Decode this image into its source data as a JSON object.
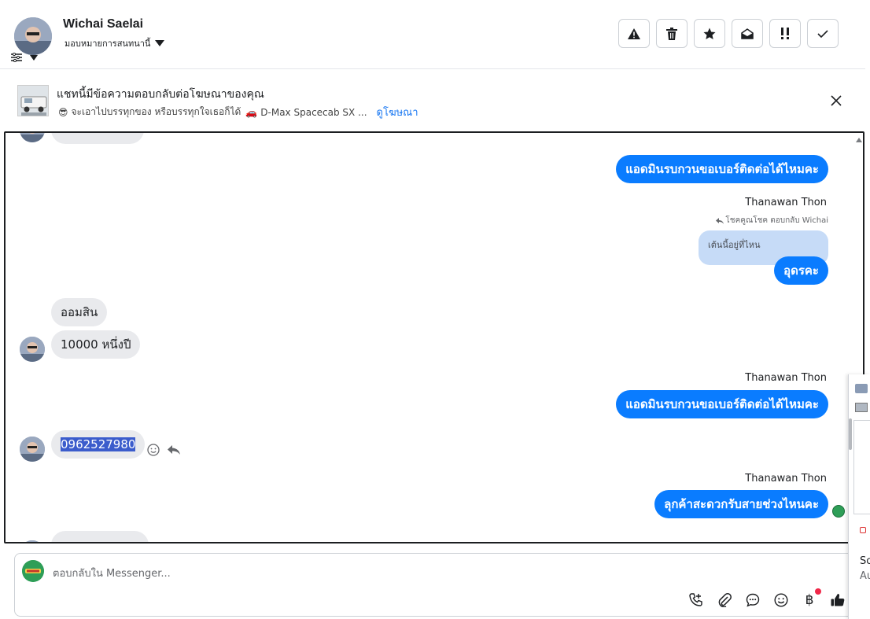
{
  "header": {
    "name": "Wichai Saelai",
    "assign_label": "มอบหมายการสนทนานี้",
    "toolbar": [
      "spam-icon",
      "trash-icon",
      "star-icon",
      "mark-unread-icon",
      "important-icon",
      "done-icon"
    ]
  },
  "banner": {
    "title": "แชทนี้มีข้อความตอบกลับต่อโฆษณาของคุณ",
    "emoji": "😎",
    "subtitle": "จะเอาไปบรรทุกของ หรือบรรทุกใจเธอก็ได้",
    "car_emoji": "🚗",
    "ad_name": "D-Max Spacecab SX ...",
    "link_label": "ดูโฆษณา"
  },
  "messages": {
    "out1": "แอดมินรบกวนขอเบอร์ติดต่อได้ไหมคะ",
    "sender1": "Thanawan Thon",
    "reply_note": "โชคคูณโชค ตอบกลับ Wichai",
    "quote": "เต้นนี้อยู่ที่ไหน",
    "out2": "อุดรคะ",
    "in1": "ออมสิน",
    "in2": "10000 หนึ่งปี",
    "sender2": "Thanawan Thon",
    "out3": "แอดมินรบกวนขอเบอร์ติดต่อได้ไหมคะ",
    "in3": "0962527980",
    "sender3": "Thanawan Thon",
    "out4": "ลุกค้าสะดวกรับสายช่วงไหนคะ"
  },
  "composer": {
    "placeholder": "ตอบกลับใน Messenger...",
    "currency_symbol": "฿"
  },
  "side": {
    "line1": "So",
    "line2": "Au"
  }
}
